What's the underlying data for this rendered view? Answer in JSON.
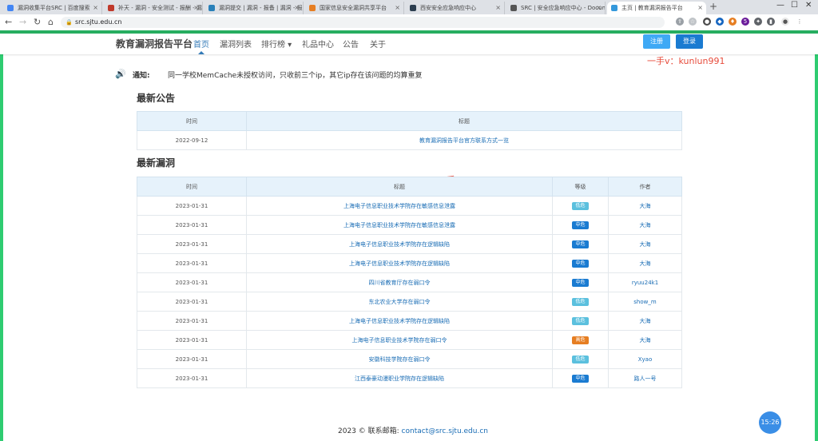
{
  "browser": {
    "tabs": [
      {
        "title": "漏洞收集平台SRC | 百度搜索",
        "favicon_color": "#4285f4",
        "active": false
      },
      {
        "title": "补天 - 漏洞 - 安全测试 - 报酬 - 漏洞 - IoT从...",
        "favicon_color": "#c0392b",
        "active": false
      },
      {
        "title": "漏洞提交 | 漏洞 - 报备 | 漏洞 - 报告 - 漏洞如何...",
        "favicon_color": "#2980b9",
        "active": false
      },
      {
        "title": "国家信息安全漏洞共享平台",
        "favicon_color": "#e67e22",
        "active": false
      },
      {
        "title": "西安安全应急响应中心",
        "favicon_color": "#2c3e50",
        "active": false
      },
      {
        "title": "SRC | 安全应急响应中心 - Docum...",
        "favicon_color": "#555555",
        "active": false
      },
      {
        "title": "主页 | 教育漏洞报告平台",
        "favicon_color": "#3498db",
        "active": true
      }
    ],
    "new_tab": "+",
    "url": "src.sjtu.edu.cn",
    "extension_badge": "5"
  },
  "site": {
    "brand": "教育漏洞报告平台",
    "nav": [
      "首页",
      "漏洞列表",
      "排行榜 ▾",
      "礼品中心",
      "公告",
      "关于"
    ],
    "register": "注册",
    "login": "登录",
    "watermark": "一手v：kunlun991"
  },
  "notice": {
    "label": "通知:",
    "text": "同一学校MemCache未授权访问，只收前三个ip，其它ip存在该问题的均算重复"
  },
  "announcements": {
    "title": "最新公告",
    "headers": [
      "时间",
      "标题"
    ],
    "rows": [
      {
        "date": "2022-09-12",
        "title": "教育漏洞报告平台官方联系方式一览"
      }
    ]
  },
  "vulns": {
    "title": "最新漏洞",
    "headers": [
      "时间",
      "标题",
      "等级",
      "作者"
    ],
    "rows": [
      {
        "date": "2023-01-31",
        "title": "上海电子信息职业技术学院存在敏感信息泄露",
        "level": "低危",
        "author": "大海"
      },
      {
        "date": "2023-01-31",
        "title": "上海电子信息职业技术学院存在敏感信息泄露",
        "level": "中危",
        "author": "大海"
      },
      {
        "date": "2023-01-31",
        "title": "上海电子信息职业技术学院存在逻辑缺陷",
        "level": "中危",
        "author": "大海"
      },
      {
        "date": "2023-01-31",
        "title": "上海电子信息职业技术学院存在逻辑缺陷",
        "level": "中危",
        "author": "大海"
      },
      {
        "date": "2023-01-31",
        "title": "四川省教育厅存在弱口令",
        "level": "中危",
        "author": "ryuu24k1"
      },
      {
        "date": "2023-01-31",
        "title": "东北农业大学存在弱口令",
        "level": "低危",
        "author": "show_m"
      },
      {
        "date": "2023-01-31",
        "title": "上海电子信息职业技术学院存在逻辑缺陷",
        "level": "低危",
        "author": "大海"
      },
      {
        "date": "2023-01-31",
        "title": "上海电子信息职业技术学院存在弱口令",
        "level": "高危",
        "author": "大海"
      },
      {
        "date": "2023-01-31",
        "title": "安徽科技学院存在弱口令",
        "level": "低危",
        "author": "Xyao"
      },
      {
        "date": "2023-01-31",
        "title": "江西泰豪动漫职业学院存在逻辑缺陷",
        "level": "中危",
        "author": "路人一号"
      }
    ],
    "level_colors": {
      "低危": "#5bc0de",
      "中危": "#1a7bd1",
      "高危": "#e67e22"
    }
  },
  "footer": {
    "text": "2023 © 联系邮箱:",
    "email": "contact@src.sjtu.edu.cn"
  },
  "clock": "15:26"
}
